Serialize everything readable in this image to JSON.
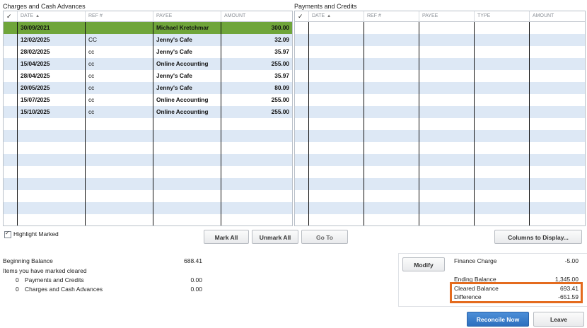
{
  "charges": {
    "title": "Charges and Cash Advances",
    "headers": {
      "check": "✓",
      "date": "DATE",
      "ref": "REF #",
      "payee": "PAYEE",
      "amount": "AMOUNT",
      "sort_icon": "▲"
    },
    "rows": [
      {
        "date": "30/09/2021",
        "ref": "",
        "payee": "Michael Kretchmar",
        "amount": "300.00",
        "selected": true
      },
      {
        "date": "12/02/2025",
        "ref": "CC",
        "payee": "Jenny's Cafe",
        "amount": "32.09"
      },
      {
        "date": "28/02/2025",
        "ref": "cc",
        "payee": "Jenny's Cafe",
        "amount": "35.97"
      },
      {
        "date": "15/04/2025",
        "ref": "cc",
        "payee": "Online Accounting",
        "amount": "255.00"
      },
      {
        "date": "28/04/2025",
        "ref": "cc",
        "payee": "Jenny's Cafe",
        "amount": "35.97"
      },
      {
        "date": "20/05/2025",
        "ref": "cc",
        "payee": "Jenny's Cafe",
        "amount": "80.09"
      },
      {
        "date": "15/07/2025",
        "ref": "cc",
        "payee": "Online Accounting",
        "amount": "255.00"
      },
      {
        "date": "15/10/2025",
        "ref": "cc",
        "payee": "Online Accounting",
        "amount": "255.00"
      }
    ]
  },
  "payments": {
    "title": "Payments and Credits",
    "headers": {
      "check": "✓",
      "date": "DATE",
      "ref": "REF #",
      "payee": "PAYEE",
      "type": "TYPE",
      "amount": "AMOUNT",
      "sort_icon": "▲"
    }
  },
  "controls": {
    "highlight_label": "Highlight Marked",
    "highlight_checked": true,
    "mark_all": "Mark All",
    "unmark_all": "Unmark All",
    "go_to": "Go To",
    "columns_to_display": "Columns to Display..."
  },
  "summary": {
    "beginning_balance_label": "Beginning Balance",
    "beginning_balance": "688.41",
    "marked_cleared_label": "Items you have marked cleared",
    "payments_count": "0",
    "payments_label": "Payments and Credits",
    "payments_amount": "0.00",
    "charges_count": "0",
    "charges_label": "Charges and Cash Advances",
    "charges_amount": "0.00"
  },
  "balances": {
    "modify": "Modify",
    "finance_charge_label": "Finance Charge",
    "finance_charge": "-5.00",
    "ending_balance_label": "Ending Balance",
    "ending_balance": "1,345.00",
    "cleared_balance_label": "Cleared Balance",
    "cleared_balance": "693.41",
    "difference_label": "Difference",
    "difference": "-651.59",
    "highlight_color": "#e46b1e"
  },
  "actions": {
    "reconcile_now": "Reconcile Now",
    "leave": "Leave"
  }
}
